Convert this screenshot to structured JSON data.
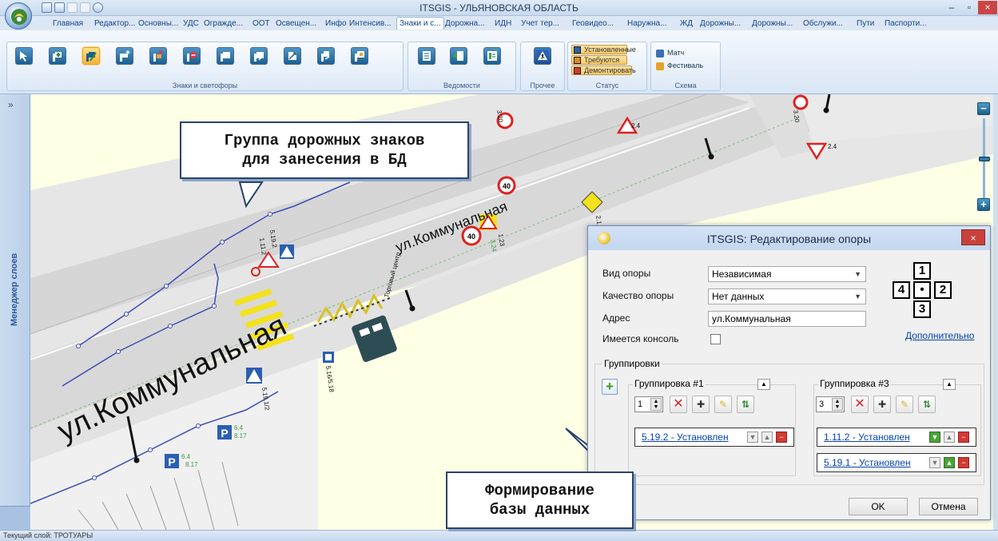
{
  "window": {
    "title": "ITSGIS - УЛЬЯНОВСКАЯ ОБЛАСТЬ",
    "minimize": "–",
    "restore": "▫",
    "close": "×"
  },
  "ribbon_tabs": [
    "Главная",
    "Редактор...",
    "Основны...",
    "УДС",
    "Огражде...",
    "ООТ",
    "Освещен...",
    "Инфо",
    "Интенсив...",
    "Знаки и с...",
    "Дорожна...",
    "ИДН",
    "Учет тер...",
    "Геовидео...",
    "Наружна...",
    "ЖД",
    "Дорожны...",
    "Дорожны...",
    "Обслужи...",
    "Пути",
    "Паспорти..."
  ],
  "active_tab_index": 9,
  "ribbon_groups": {
    "signs": "Знаки и светофоры",
    "statements": "Ведомости",
    "other": "Прочее",
    "status": "Статус",
    "scheme": "Схема"
  },
  "status_buttons": [
    "Установленные",
    "Требуются",
    "Демонтировать"
  ],
  "scheme_items": [
    "Матч",
    "Фестиваль"
  ],
  "layer_panel": {
    "label": "Менеджер слоев",
    "toggle": "»"
  },
  "map": {
    "street_large": "ул.Коммунальная",
    "street_small": "ул.Коммунальная",
    "shopping_center": "Торговый центр",
    "sign_labels": {
      "a": "3.20",
      "b": "3.20",
      "c": "2.4",
      "d": "2.4",
      "e": "2.1",
      "f": "1.23",
      "g": "3.24",
      "h": "5.19.2",
      "i": "1.11.2",
      "j": "5.19.1/2",
      "k": "5.16/5.18",
      "l": "6.4",
      "m": "8.17",
      "n": "6.4",
      "o": "8.17"
    },
    "speed_limit": "40",
    "parking": "P"
  },
  "callouts": {
    "top_line1": "Группа дорожных знаков",
    "top_line2": "для занесения в БД",
    "bottom_line1": "Формирование",
    "bottom_line2": "базы данных"
  },
  "dialog": {
    "title": "ITSGIS: Редактирование опоры",
    "close": "×",
    "fields": {
      "support_type_label": "Вид опоры",
      "support_type_value": "Независимая",
      "quality_label": "Качество опоры",
      "quality_value": "Нет данных",
      "address_label": "Адрес",
      "address_value": "ул.Коммунальная",
      "console_label": "Имеется консоль"
    },
    "position_grid": [
      "1",
      "•",
      "2",
      "3",
      "4"
    ],
    "more_link": "Дополнительно",
    "groups_label": "Группировки",
    "group1": {
      "title": "Группировка #1",
      "counter": "1",
      "items": [
        "5.19.2 - Установлен"
      ]
    },
    "group3": {
      "title": "Группировка #3",
      "counter": "3",
      "items": [
        "1.11.2 - Установлен",
        "5.19.1 - Установлен"
      ]
    },
    "ok": "OK",
    "cancel": "Отмена"
  },
  "statusbar": {
    "text": "Текущий слой: ТРОТУАРЫ"
  }
}
